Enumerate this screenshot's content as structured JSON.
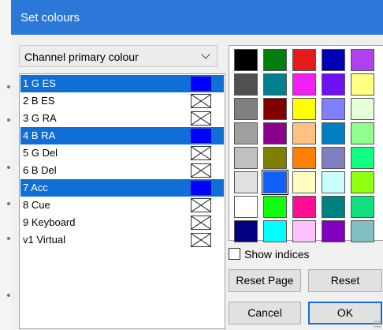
{
  "window": {
    "title": "Set colours"
  },
  "colour_type": {
    "selected": "Channel primary colour"
  },
  "channels": [
    {
      "label": "1 G ES",
      "selected": true,
      "swatch": "#0000ff"
    },
    {
      "label": "2 B ES",
      "selected": false,
      "swatch": null
    },
    {
      "label": "3 G RA",
      "selected": false,
      "swatch": null
    },
    {
      "label": "4 B RA",
      "selected": true,
      "swatch": "#0000ff"
    },
    {
      "label": "5 G Del",
      "selected": false,
      "swatch": null
    },
    {
      "label": "6 B Del",
      "selected": false,
      "swatch": null
    },
    {
      "label": "7 Acc",
      "selected": true,
      "swatch": "#0000ff"
    },
    {
      "label": "8 Cue",
      "selected": false,
      "swatch": null
    },
    {
      "label": "9 Keyboard",
      "selected": false,
      "swatch": null
    },
    {
      "label": "v1 Virtual",
      "selected": false,
      "swatch": null
    }
  ],
  "palette": {
    "colors": [
      [
        "#000000",
        "#007f0e",
        "#e51a1a",
        "#0000b4",
        "#b040f0"
      ],
      [
        "#505050",
        "#00808c",
        "#f020f0",
        "#6e10f0",
        "#ffff80"
      ],
      [
        "#808080",
        "#800000",
        "#ffff00",
        "#8080ff",
        "#e6ffd7"
      ],
      [
        "#a0a0a0",
        "#8c008c",
        "#ffc080",
        "#0080c0",
        "#90ff90"
      ],
      [
        "#c0c0c0",
        "#808000",
        "#ff8000",
        "#8080c0",
        "#10ff80"
      ],
      [
        "#e0e0e0",
        "#1060ff",
        "#ffffc0",
        "#c8ffff",
        "#90ff10"
      ],
      [
        "#ffffff",
        "#10ff10",
        "#ff1090",
        "#008080",
        "#10e080"
      ],
      [
        "#000080",
        "#00ffff",
        "#ffc0ff",
        "#8000c0",
        "#80c0c0"
      ]
    ],
    "selected": [
      5,
      1
    ]
  },
  "show_indices": {
    "label": "Show indices",
    "checked": false
  },
  "buttons": {
    "reset_page": "Reset Page",
    "reset": "Reset",
    "cancel": "Cancel",
    "ok": "OK"
  }
}
